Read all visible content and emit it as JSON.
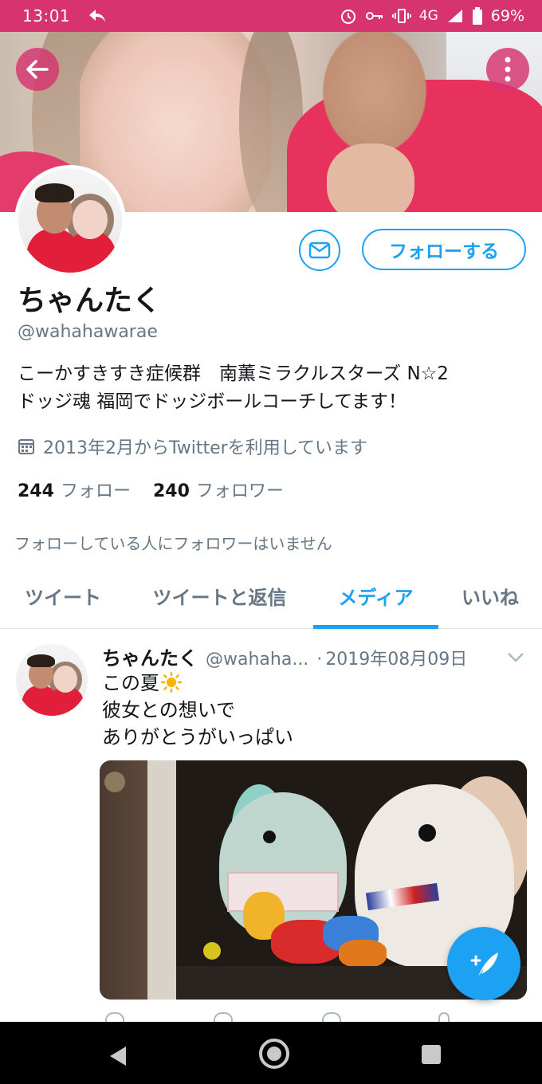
{
  "status_bar": {
    "time": "13:01",
    "network": "4G",
    "battery": "69%",
    "icons": [
      "reply-icon",
      "alarm-icon",
      "key-icon",
      "vibrate-icon",
      "signal-icon",
      "battery-icon"
    ]
  },
  "header": {
    "back_icon": "arrow-left-icon",
    "more_icon": "more-vertical-icon"
  },
  "profile": {
    "display_name": "ちゃんたく",
    "handle": "@wahahawarae",
    "bio_line1": "こーかすきすき症候群　南薫ミラクルスターズ N☆2",
    "bio_line2": "ドッジ魂 福岡でドッジボールコーチしてます！",
    "joined": "2013年2月からTwitterを利用しています",
    "following_count": "244",
    "following_label": "フォロー",
    "followers_count": "240",
    "followers_label": "フォロワー",
    "no_followers_you_know": "フォローしている人にフォロワーはいません",
    "follow_button": "フォローする"
  },
  "tabs": [
    {
      "label": "ツイート"
    },
    {
      "label": "ツイートと返信"
    },
    {
      "label": "メディア",
      "active": true
    },
    {
      "label": "いいね"
    }
  ],
  "tweet": {
    "name": "ちゃんたく",
    "handle": "@wahaha...",
    "dot": "·",
    "date": "2019年08月09日",
    "line1": "この夏",
    "line2": "彼女との想いで",
    "line3": "ありがとうがいっぱい"
  },
  "colors": {
    "accent": "#1da1f2",
    "status_bar": "#d6336f",
    "secondary_text": "#657786"
  }
}
